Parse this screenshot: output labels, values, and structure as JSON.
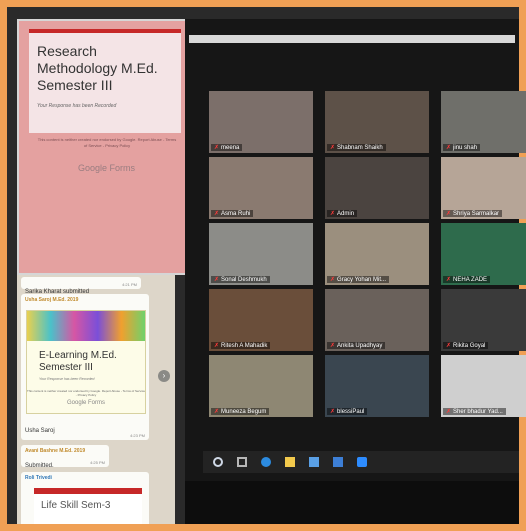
{
  "forms_card": {
    "title": "Research Methodology M.Ed. Semester III",
    "response": "Your Response has been Recorded",
    "note": "This content is neither created nor endorsed by Google. Report Abuse - Terms of Service - Privacy Policy",
    "brand": "Google Forms"
  },
  "chat": {
    "messages": [
      {
        "text": "Sarika Kharat submitted",
        "time": "4:21 PM"
      },
      {
        "sender": "Usha Saroj M.Ed. 2019"
      },
      {
        "card_title": "E-Learning M.Ed. Semester III",
        "card_response": "Your Response has been Recorded",
        "card_note": "This content is neither created nor endorsed by Google. Report Abuse - Terms of Service - Privacy Policy",
        "card_brand": "Google Forms"
      },
      {
        "text": "Usha Saroj",
        "time": "4:23 PM"
      },
      {
        "sender": "Avani Bashne M.Ed. 2019",
        "text": "Submitted.",
        "time": "4:25 PM"
      },
      {
        "sender": "Roli Trivedi"
      },
      {
        "card_title": "Life Skill Sem-3"
      }
    ],
    "scroll_icon": "chevron-icon"
  },
  "participants": [
    {
      "name": "meena",
      "color": "#7c6f6a"
    },
    {
      "name": "Shabnam Shaikh",
      "color": "#5d5148"
    },
    {
      "name": "jinu shah",
      "color": "#6f6f6a"
    },
    {
      "name": "Asma Ruhi",
      "color": "#8a7a70"
    },
    {
      "name": "Admin",
      "color": "#4b4440"
    },
    {
      "name": "Shriya Sarmalkar",
      "color": "#b6a597"
    },
    {
      "name": "Sonal Deshmukh",
      "color": "#8c8c88"
    },
    {
      "name": "Gracy Yohan Mit...",
      "color": "#9b8f7e"
    },
    {
      "name": "NEHA ZADE",
      "color": "#2e6b4c"
    },
    {
      "name": "Ritesh A Mahadik",
      "color": "#6a4e3a"
    },
    {
      "name": "Ankita Upadhyay",
      "color": "#6a615b"
    },
    {
      "name": "Rikita Goyal",
      "color": "#3a3a3a"
    },
    {
      "name": "Muneeza Begum",
      "color": "#8e8773"
    },
    {
      "name": "blessiPaul",
      "color": "#3a4650"
    },
    {
      "name": "Sher bhadur Yad...",
      "color": "#cfcfcf"
    }
  ],
  "taskbar": [
    "windows-icon",
    "task-view-icon",
    "edge-icon",
    "explorer-icon",
    "store-icon",
    "mail-icon",
    "zoom-icon"
  ]
}
